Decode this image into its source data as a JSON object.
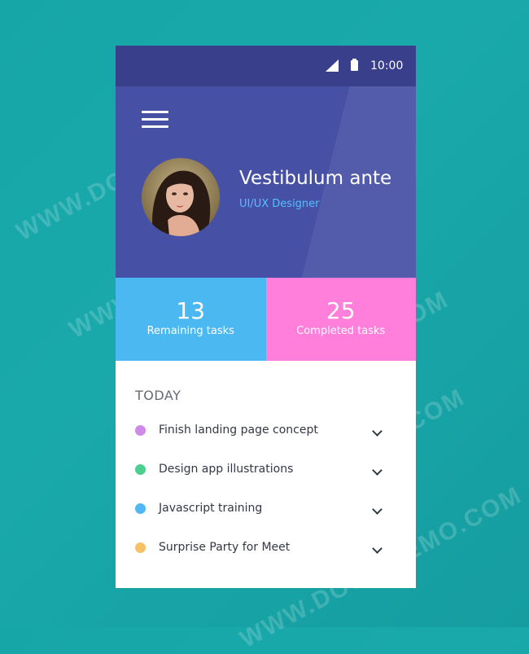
{
  "watermark": "WWW.DOWNDEMO.COM",
  "status_bar": {
    "time": "10:00"
  },
  "profile": {
    "name": "Vestibulum ante",
    "role": "UI/UX Designer"
  },
  "stats": [
    {
      "value": "13",
      "label": "Remaining tasks"
    },
    {
      "value": "25",
      "label": "Completed tasks"
    }
  ],
  "today": {
    "title": "TODAY",
    "tasks": [
      {
        "label": "Finish landing page concept",
        "color": "#cf8ae8"
      },
      {
        "label": "Design app illustrations",
        "color": "#4cd08f"
      },
      {
        "label": "Javascript training",
        "color": "#4fb8f4"
      },
      {
        "label": "Surprise Party for Meet",
        "color": "#f7c266"
      }
    ]
  },
  "colors": {
    "status_bar": "#3a3f8c",
    "header": "#4650a5",
    "remaining": "#4cb8f2",
    "completed": "#ff7fdb",
    "role_text": "#55c0ff"
  },
  "icons": {
    "menu": "hamburger-icon",
    "signal": "signal-icon",
    "battery": "battery-icon",
    "expand": "chevron-down-icon"
  }
}
